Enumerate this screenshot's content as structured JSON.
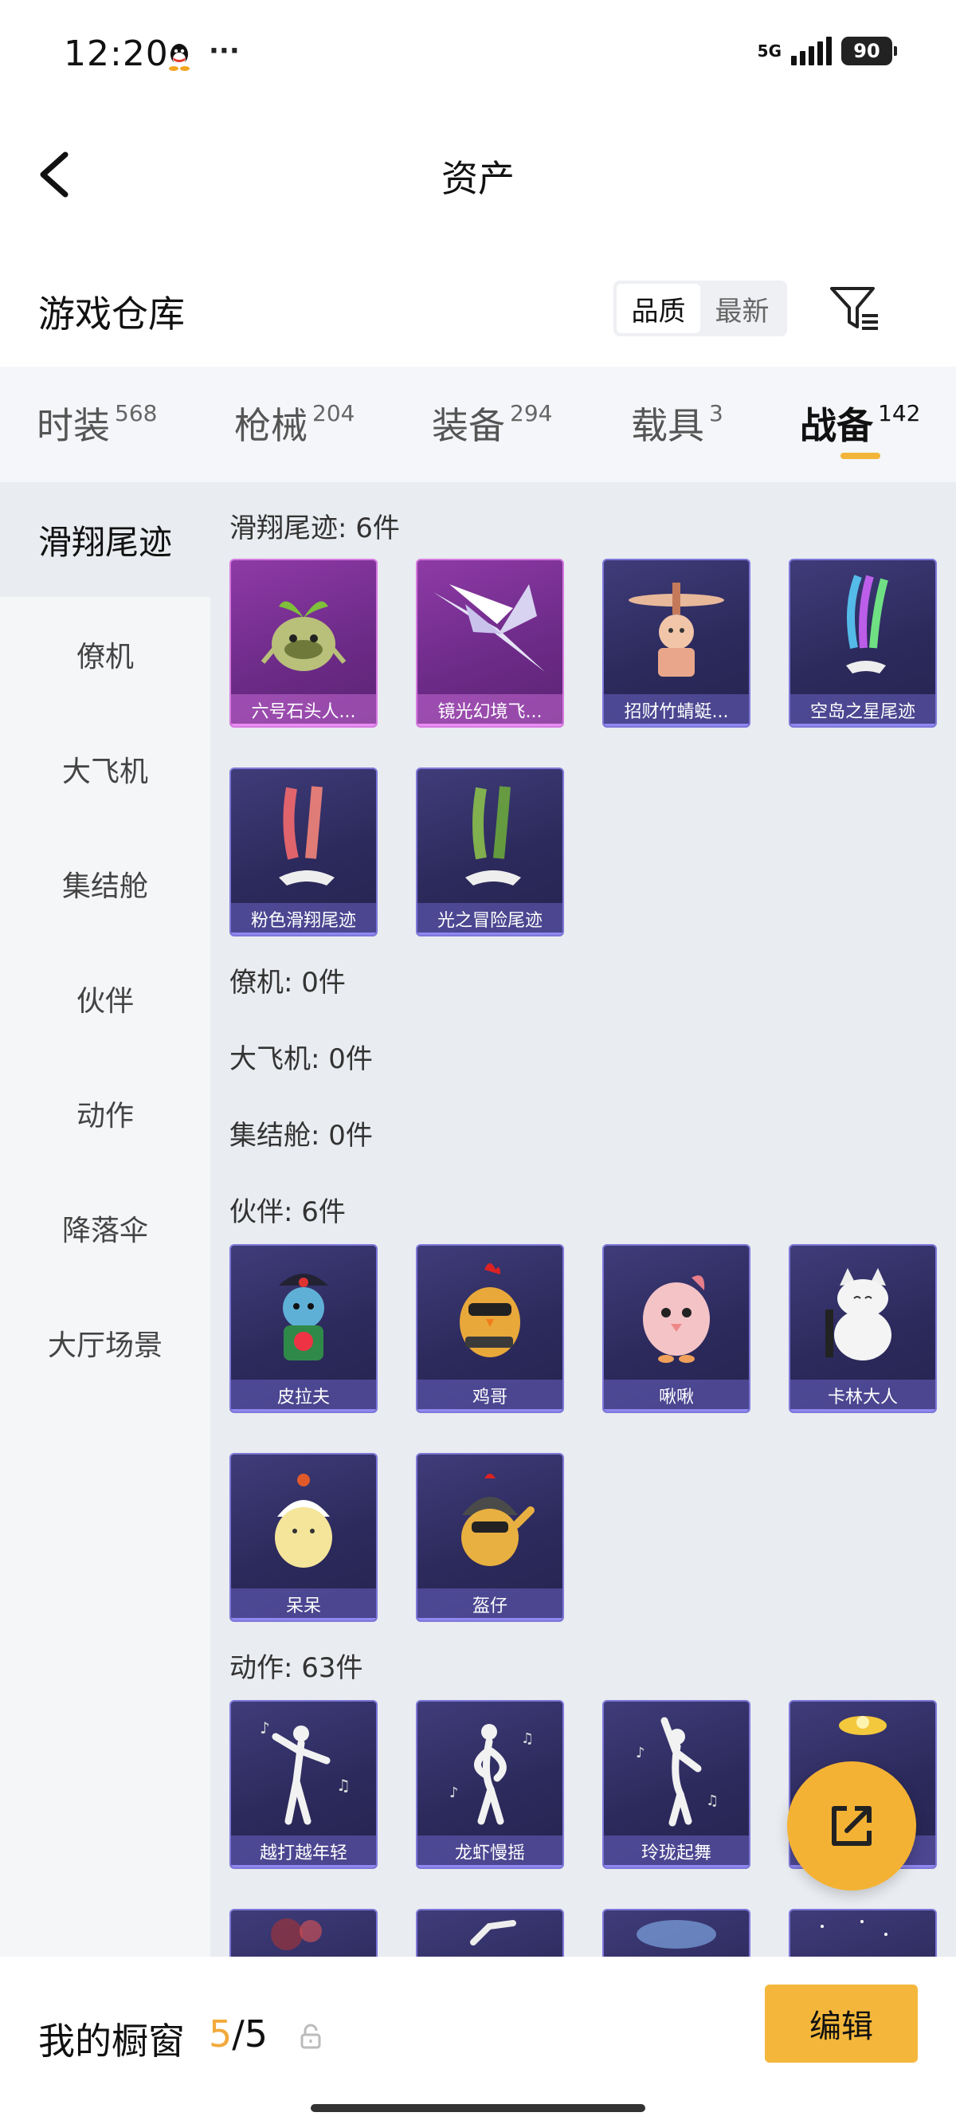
{
  "status": {
    "time": "12:20",
    "dots": "···",
    "network": "5G",
    "battery": "90"
  },
  "nav": {
    "title": "资产"
  },
  "warehouse": {
    "title": "游戏仓库",
    "sort": [
      "品质",
      "最新"
    ]
  },
  "tabs": [
    {
      "label": "时装",
      "count": "568"
    },
    {
      "label": "枪械",
      "count": "204"
    },
    {
      "label": "装备",
      "count": "294"
    },
    {
      "label": "载具",
      "count": "3"
    },
    {
      "label": "战备",
      "count": "142"
    }
  ],
  "sidebar": [
    "滑翔尾迹",
    "僚机",
    "大飞机",
    "集结舱",
    "伙伴",
    "动作",
    "降落伞",
    "大厅场景"
  ],
  "sections": {
    "glide": "滑翔尾迹: 6件",
    "wingman": "僚机: 0件",
    "bigplane": "大飞机: 0件",
    "pod": "集结舱: 0件",
    "partner": "伙伴: 6件",
    "action": "动作: 63件"
  },
  "glide_items": [
    "六号石头人...",
    "镜光幻境飞...",
    "招财竹蜻蜓...",
    "空岛之星尾迹",
    "粉色滑翔尾迹",
    "光之冒险尾迹"
  ],
  "partner_items": [
    "皮拉夫",
    "鸡哥",
    "啾啾",
    "卡林大人",
    "呆呆",
    "盔仔"
  ],
  "action_items": [
    "越打越年轻",
    "龙虾慢摇",
    "玲珑起舞",
    ""
  ],
  "bottom": {
    "label": "我的橱窗",
    "current": "5",
    "sep": "/",
    "total": "5",
    "edit": "编辑"
  },
  "colors": {
    "accent": "#f4b73c",
    "card_purple": "#3f3c7a",
    "card_pink": "#8e3aa6"
  }
}
